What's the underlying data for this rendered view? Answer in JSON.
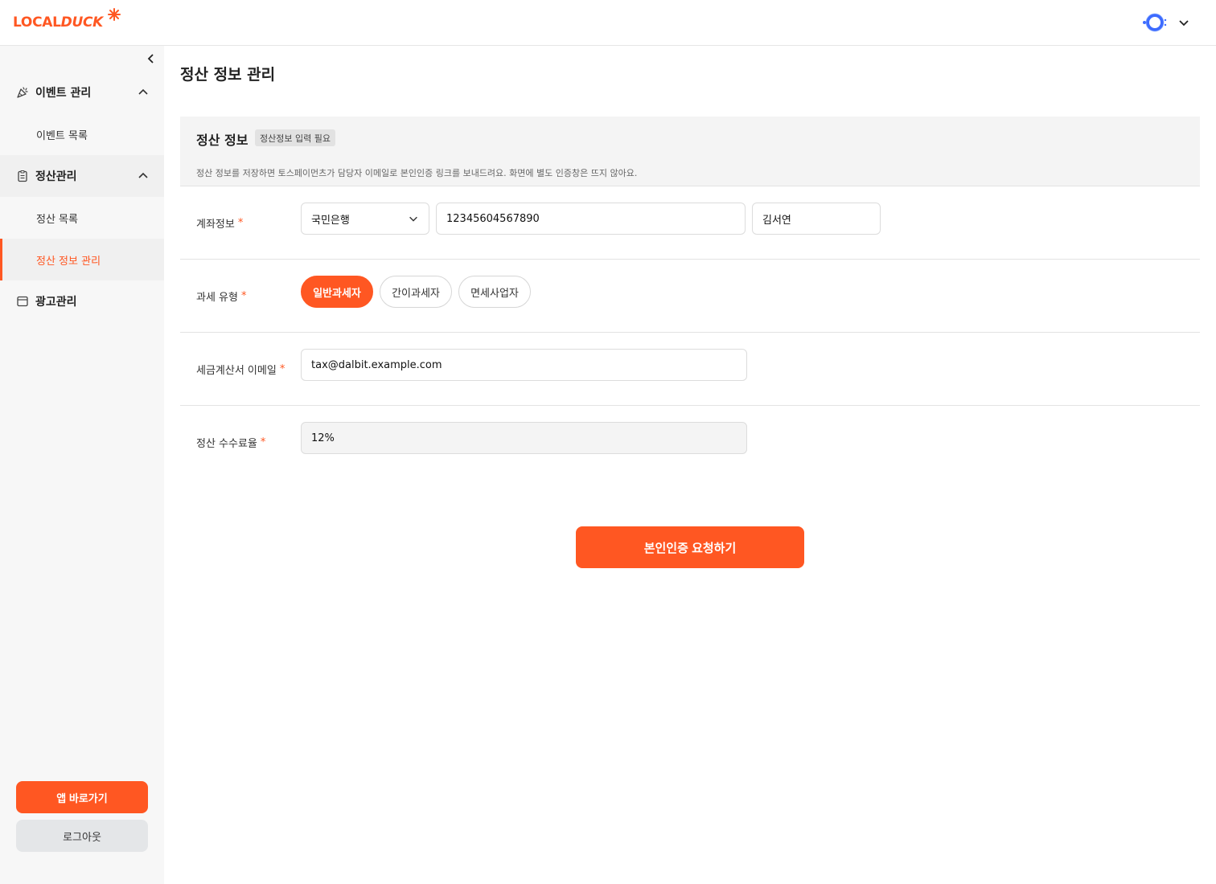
{
  "header": {
    "logo_text_a": "LOCAL",
    "logo_text_b": "DUCK"
  },
  "sidebar": {
    "groups": [
      {
        "label": "이벤트 관리",
        "icon": "party-popper-icon"
      },
      {
        "label": "정산관리",
        "icon": "clipboard-icon"
      },
      {
        "label": "광고관리",
        "icon": "window-icon"
      }
    ],
    "subitems": [
      {
        "label": "이벤트 목록"
      },
      {
        "label": "정산 목록"
      },
      {
        "label": "정산 정보 관리"
      }
    ],
    "app_button": "앱 바로가기",
    "logout_button": "로그아웃"
  },
  "page": {
    "title": "정산 정보 관리"
  },
  "section": {
    "title": "정산 정보",
    "badge": "정산정보 입력 필요",
    "description": "정산 정보를 저장하면 토스페이먼츠가 담당자 이메일로 본인인증 링크를 보내드려요. 화면에 별도 인증창은 뜨지 않아요."
  },
  "form": {
    "account": {
      "label": "계좌정보",
      "required": "*",
      "bank": "국민은행",
      "number": "12345604567890",
      "holder": "김서연"
    },
    "tax_type": {
      "label": "과세 유형",
      "required": "*",
      "options": [
        "일반과세자",
        "간이과세자",
        "면세사업자"
      ],
      "selected": "일반과세자"
    },
    "email": {
      "label": "세금계산서 이메일",
      "required": "*",
      "value": "tax@dalbit.example.com"
    },
    "fee": {
      "label": "정산 수수료율",
      "required": "*",
      "value": "12%"
    }
  },
  "submit_label": "본인인증 요청하기",
  "colors": {
    "accent": "#ff5722",
    "sidebar_bg": "#f7f7f7"
  }
}
